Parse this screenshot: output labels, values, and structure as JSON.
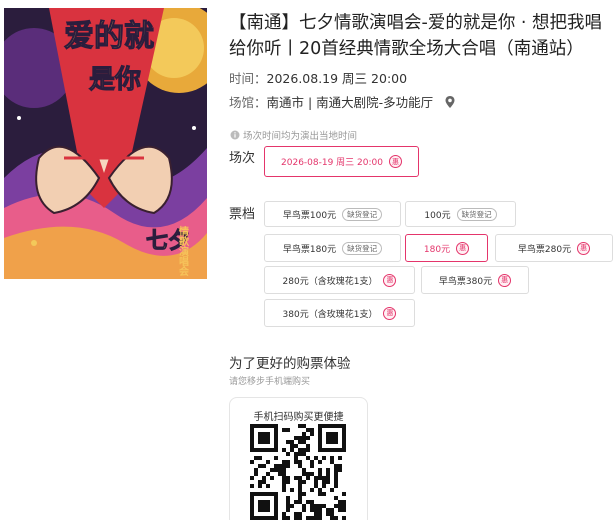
{
  "event": {
    "title": "【南通】七夕情歌演唱会-爱的就是你 · 想把我唱给你听丨20首经典情歌全场大合唱（南通站）",
    "poster": {
      "text_main": "爱的就是你",
      "text_side": "七夕",
      "text_side2": "情歌演唱会"
    },
    "time_label": "时间：",
    "time_value": "2026.08.19 周三 20:00",
    "venue_label": "场馆：",
    "venue_value": "南通市 | 南通大剧院-多功能厅",
    "location_icon": "map-pin-icon"
  },
  "timezone_note": "场次时间均为演出当地时间",
  "session": {
    "label": "场次",
    "options": [
      {
        "text": "2026-08-19 周三 20:00",
        "tag": "惠",
        "selected": true
      }
    ]
  },
  "tiers": {
    "label": "票档",
    "options": [
      {
        "text": "早鸟票100元",
        "tag": "缺货登记",
        "tag_type": "gray",
        "selected": false
      },
      {
        "text": "100元",
        "tag": "缺货登记",
        "tag_type": "gray",
        "selected": false
      },
      {
        "text": "早鸟票180元",
        "tag": "缺货登记",
        "tag_type": "gray",
        "selected": false
      },
      {
        "text": "180元",
        "tag": "惠",
        "tag_type": "pink",
        "selected": true
      },
      {
        "text": "早鸟票280元",
        "tag": "惠",
        "tag_type": "pink",
        "selected": false
      },
      {
        "text": "280元（含玫瑰花1支）",
        "tag": "惠",
        "tag_type": "pink",
        "selected": false
      },
      {
        "text": "早鸟票380元",
        "tag": "惠",
        "tag_type": "pink",
        "selected": false
      },
      {
        "text": "380元（含玫瑰花1支）",
        "tag": "惠",
        "tag_type": "pink",
        "selected": false
      }
    ]
  },
  "promo": {
    "title": "为了更好的购票体验",
    "subtitle": "请您移步手机端购买",
    "qr_title": "手机扫码购买更便捷"
  },
  "colors": {
    "accent": "#e4356b"
  }
}
